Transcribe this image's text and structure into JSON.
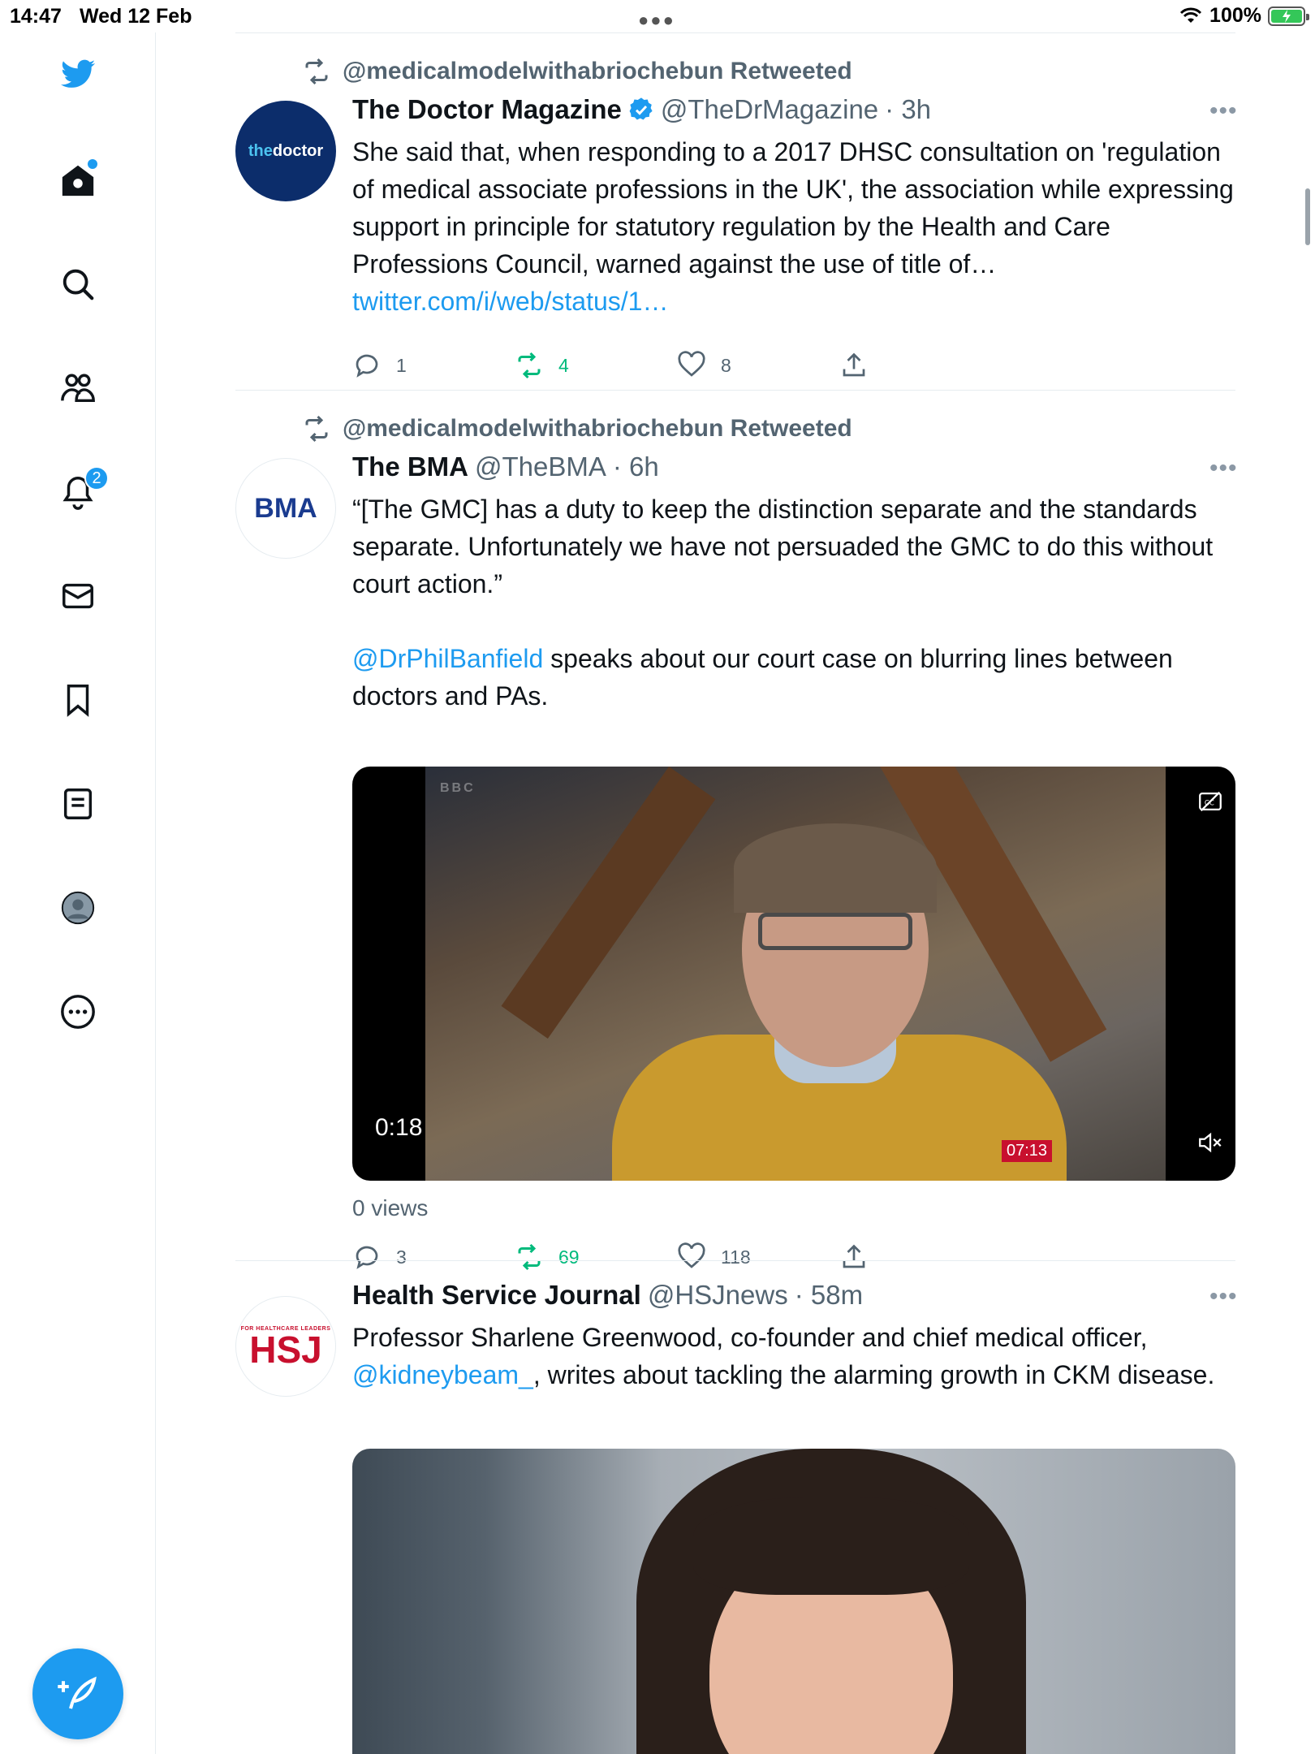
{
  "status_bar": {
    "time": "14:47",
    "date": "Wed 12 Feb",
    "battery": "100%"
  },
  "sidebar": {
    "notifications_badge": "2"
  },
  "tweets": [
    {
      "retweeted_by": "@medicalmodelwithabriochebun Retweeted",
      "name": "The Doctor Magazine",
      "handle": "@TheDrMagazine",
      "time": "· 3h",
      "verified": true,
      "avatar_text_1": "the",
      "avatar_text_2": "doctor",
      "text": "She said that, when responding to a 2017 DHSC consultation on 'regulation of medical associate professions in the UK', the association while expressing support in principle for statutory regulation by the Health and Care Professions Council, warned against the use of title of… ",
      "link": "twitter.com/i/web/status/1…",
      "replies": "1",
      "retweets": "4",
      "likes": "8"
    },
    {
      "retweeted_by": "@medicalmodelwithabriochebun Retweeted",
      "name": "The BMA",
      "handle": "@TheBMA",
      "time": "· 6h",
      "avatar_text": "BMA",
      "text_1": "“[The GMC] has a duty to keep the distinction separate and the standards separate. Unfortunately we have not persuaded the GMC to do this without court action.”",
      "mention": "@DrPhilBanfield",
      "text_2": " speaks about our court case on blurring lines between doctors and PAs.",
      "video_time": "0:18",
      "video_badge": "07:13",
      "video_watermark": "BBC",
      "views": "0 views",
      "replies": "3",
      "retweets": "69",
      "likes": "118"
    },
    {
      "name": "Health Service Journal",
      "handle": "@HSJnews",
      "time": "· 58m",
      "avatar_small": "FOR HEALTHCARE LEADERS",
      "avatar_big": "HSJ",
      "text_1": "Professor Sharlene Greenwood, co-founder and chief medical officer, ",
      "mention": "@kidneybeam_",
      "text_2": ", writes about tackling the alarming growth in CKM disease."
    }
  ],
  "colors": {
    "accent": "#1d9bf0",
    "retweet_green": "#00ba7c",
    "muted": "#536471"
  }
}
